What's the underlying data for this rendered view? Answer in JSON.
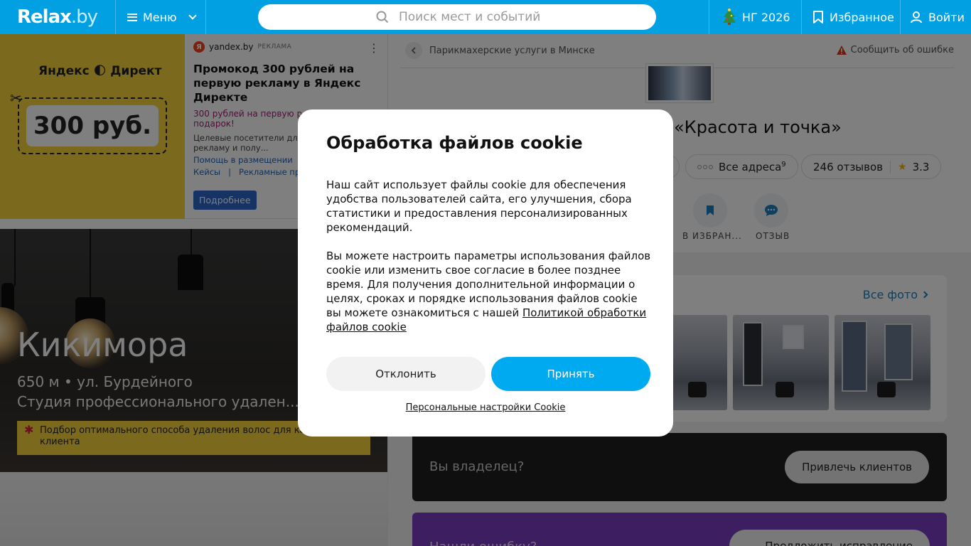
{
  "header": {
    "logo": "Relax",
    "logo_suffix": ".by",
    "menu_label": "Меню",
    "search_placeholder": "Поиск мест и событий",
    "ny_label": "НГ 2026",
    "favorites_label": "Избранное",
    "login_label": "Войти"
  },
  "ad": {
    "image_brand": "Яндекс 🌓 Директ",
    "image_coupon": "300 руб.",
    "source": "yandex.by",
    "source_badge": "Я",
    "label": "РЕКЛАМА",
    "title": "Промокод 300 рублей на первую рекламу в Яндекс Директе",
    "subtitle": "300 рублей на первую рекламу в подарок!",
    "description": "Целевые посетители для ли... Запустите рекламу и полу...",
    "link_1": "Помощь в размещении",
    "link_2": "Кейсы",
    "link_3": "Рекламные про...",
    "button": "Подробнее"
  },
  "promo": {
    "title": "Кикимора",
    "address": "650 м • ул. Бурдейного",
    "type": "Студия профессионального удален...",
    "note": "Подбор оптимального способа удаления волос для каждого клиента"
  },
  "place": {
    "breadcrumb": "Парикмахерские услуги в Минске",
    "report": "Сообщить об ошибке",
    "title": "«Красота и точка»",
    "addresses_label": "Все адреса",
    "addresses_count": "9",
    "reviews": "246 отзывов",
    "rating": "3.3",
    "action_favorite": "в избран...",
    "action_review": "отзыв",
    "all_photos": "Все фото"
  },
  "owner": {
    "text": "Вы владелец?",
    "button": "Привлечь клиентов"
  },
  "errors": {
    "text": "Нашли ошибку?",
    "button": "Предложить исправление"
  },
  "cookie": {
    "title": "Обработка файлов cookie",
    "paragraph_1": "Наш сайт использует файлы cookie для обеспечения удобства пользователей сайта, его улучшения, сбора статистики и предоставления персонализированных рекомендаций.",
    "paragraph_2": "Вы можете настроить параметры использования файлов cookie или изменить свое согласие в более позднее время. Для получения дополнительной информации о целях, сроках и порядке использования файлов cookie вы можете ознакомиться с нашей",
    "policy_link": "Политикой обработки файлов cookie",
    "decline": "Отклонить",
    "accept": "Принять",
    "settings_link": "Персональные настройки Cookie"
  },
  "colors": {
    "header_bg": "#00a0e3",
    "accept_bg": "#00aaf0",
    "ad_yellow": "#f7d33d",
    "owner_bg": "#1e1e1e",
    "errors_bg": "#7a3ec2"
  }
}
